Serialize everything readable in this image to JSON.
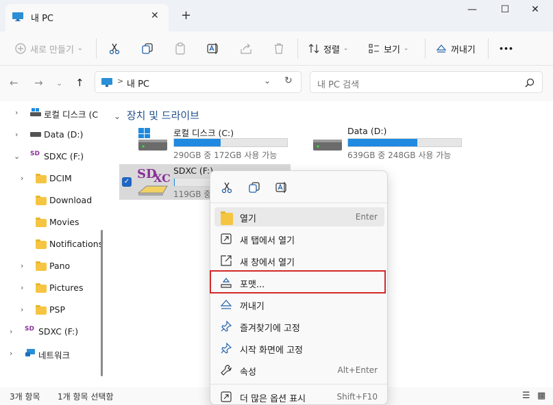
{
  "window": {
    "tab_title": "내 PC",
    "close_tab": "✕",
    "new_tab": "+",
    "min": "—",
    "max": "☐",
    "close": "✕"
  },
  "toolbar": {
    "new_label": "새로 만들기",
    "sort_label": "정렬",
    "view_label": "보기",
    "eject_label": "꺼내기",
    "more_label": "•••"
  },
  "address": {
    "path_separator": ">",
    "path": "내 PC",
    "search_placeholder": "내 PC 검색"
  },
  "sidebar": {
    "items": [
      {
        "label": "로컬 디스크 (C"
      },
      {
        "label": "Data (D:)"
      },
      {
        "label": "SDXC (F:)"
      },
      {
        "label": "DCIM"
      },
      {
        "label": "Download"
      },
      {
        "label": "Movies"
      },
      {
        "label": "Notifications"
      },
      {
        "label": "Pano"
      },
      {
        "label": "Pictures"
      },
      {
        "label": "PSP"
      },
      {
        "label": "SDXC (F:)"
      },
      {
        "label": "네트워크"
      }
    ]
  },
  "main": {
    "group_title": "장치 및 드라이브",
    "drives": [
      {
        "name": "로컬 디스크 (C:)",
        "sub": "290GB 중 172GB 사용 가능",
        "used_fraction": 0.41
      },
      {
        "name": "Data (D:)",
        "sub": "639GB 중 248GB 사용 가능",
        "used_fraction": 0.61
      },
      {
        "name": "SDXC (F:)",
        "sub": "119GB 중",
        "used_fraction": 0.02
      }
    ]
  },
  "status": {
    "count": "3개 항목",
    "selected": "1개 항목 선택함"
  },
  "context_menu": {
    "items": [
      {
        "label": "열기",
        "accel": "Enter"
      },
      {
        "label": "새 탭에서 열기",
        "accel": ""
      },
      {
        "label": "새 창에서 열기",
        "accel": ""
      },
      {
        "label": "포맷...",
        "accel": ""
      },
      {
        "label": "꺼내기",
        "accel": ""
      },
      {
        "label": "즐겨찾기에 고정",
        "accel": ""
      },
      {
        "label": "시작 화면에 고정",
        "accel": ""
      },
      {
        "label": "속성",
        "accel": "Alt+Enter"
      },
      {
        "label": "더 많은 옵션 표시",
        "accel": "Shift+F10"
      }
    ]
  },
  "colors": {
    "accent": "#1f8ae0",
    "highlight_border": "#d32727",
    "folder": "#f5c542"
  }
}
